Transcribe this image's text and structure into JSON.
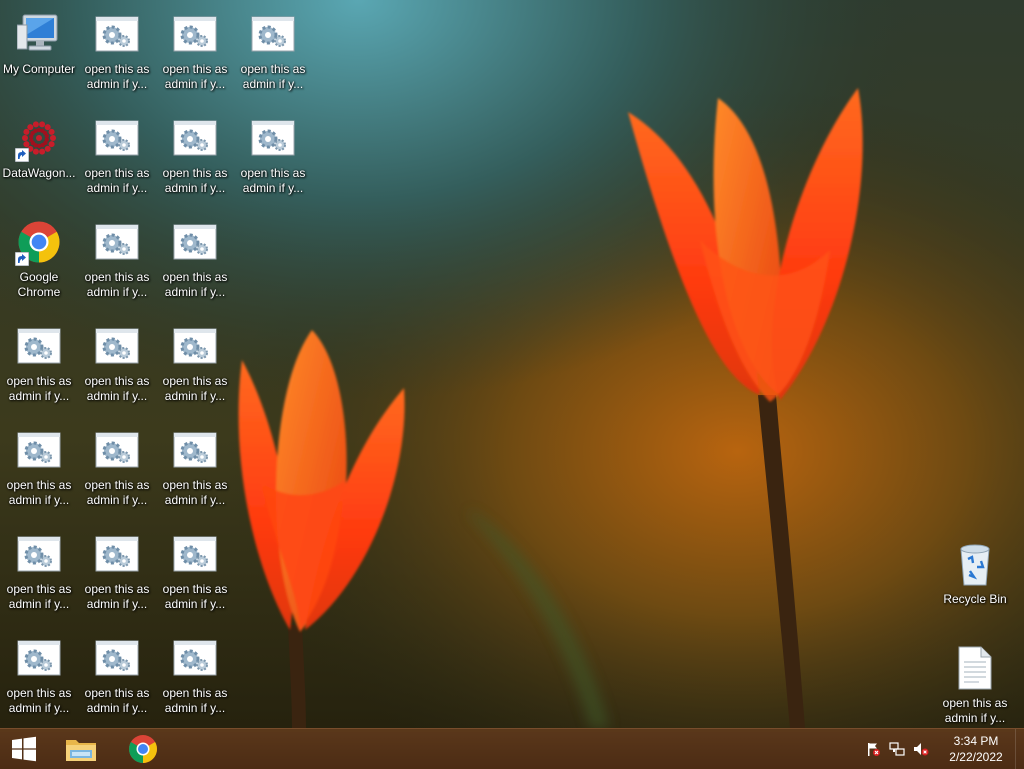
{
  "desktop": {
    "icons": [
      {
        "id": "my-computer",
        "label": "My Computer",
        "kind": "computer-icon",
        "col": 0,
        "row": 0
      },
      {
        "id": "datawagon",
        "label": "DataWagon...",
        "kind": "datawagon-icon",
        "col": 0,
        "row": 1,
        "shortcut": true
      },
      {
        "id": "google-chrome",
        "label": "Google\nChrome",
        "kind": "chrome-icon",
        "col": 0,
        "row": 2,
        "shortcut": true
      },
      {
        "id": "admin-0-3",
        "label": "open this as\nadmin if y...",
        "kind": "settings-file-icon",
        "col": 0,
        "row": 3
      },
      {
        "id": "admin-0-4",
        "label": "open this as\nadmin if y...",
        "kind": "settings-file-icon",
        "col": 0,
        "row": 4
      },
      {
        "id": "admin-0-5",
        "label": "open this as\nadmin if y...",
        "kind": "settings-file-icon",
        "col": 0,
        "row": 5
      },
      {
        "id": "admin-0-6",
        "label": "open this as\nadmin if y...",
        "kind": "settings-file-icon",
        "col": 0,
        "row": 6
      },
      {
        "id": "admin-1-0",
        "label": "open this as\nadmin if y...",
        "kind": "settings-file-icon",
        "col": 1,
        "row": 0
      },
      {
        "id": "admin-1-1",
        "label": "open this as\nadmin if y...",
        "kind": "settings-file-icon",
        "col": 1,
        "row": 1
      },
      {
        "id": "admin-1-2",
        "label": "open this as\nadmin if y...",
        "kind": "settings-file-icon",
        "col": 1,
        "row": 2
      },
      {
        "id": "admin-1-3",
        "label": "open this as\nadmin if y...",
        "kind": "settings-file-icon",
        "col": 1,
        "row": 3
      },
      {
        "id": "admin-1-4",
        "label": "open this as\nadmin if y...",
        "kind": "settings-file-icon",
        "col": 1,
        "row": 4
      },
      {
        "id": "admin-1-5",
        "label": "open this as\nadmin if y...",
        "kind": "settings-file-icon",
        "col": 1,
        "row": 5
      },
      {
        "id": "admin-1-6",
        "label": "open this as\nadmin if y...",
        "kind": "settings-file-icon",
        "col": 1,
        "row": 6
      },
      {
        "id": "admin-2-0",
        "label": "open this as\nadmin if y...",
        "kind": "settings-file-icon",
        "col": 2,
        "row": 0
      },
      {
        "id": "admin-2-1",
        "label": "open this as\nadmin if y...",
        "kind": "settings-file-icon",
        "col": 2,
        "row": 1
      },
      {
        "id": "admin-2-2",
        "label": "open this as\nadmin if y...",
        "kind": "settings-file-icon",
        "col": 2,
        "row": 2
      },
      {
        "id": "admin-2-3",
        "label": "open this as\nadmin if y...",
        "kind": "settings-file-icon",
        "col": 2,
        "row": 3
      },
      {
        "id": "admin-2-4",
        "label": "open this as\nadmin if y...",
        "kind": "settings-file-icon",
        "col": 2,
        "row": 4
      },
      {
        "id": "admin-2-5",
        "label": "open this as\nadmin if y...",
        "kind": "settings-file-icon",
        "col": 2,
        "row": 5
      },
      {
        "id": "admin-2-6",
        "label": "open this as\nadmin if y...",
        "kind": "settings-file-icon",
        "col": 2,
        "row": 6
      },
      {
        "id": "admin-3-0",
        "label": "open this as\nadmin if y...",
        "kind": "settings-file-icon",
        "col": 3,
        "row": 0
      },
      {
        "id": "admin-3-1",
        "label": "open this as\nadmin if y...",
        "kind": "settings-file-icon",
        "col": 3,
        "row": 1
      }
    ],
    "right_icons": [
      {
        "id": "recycle-bin",
        "label": "Recycle Bin",
        "kind": "recycle-bin-icon",
        "row": 5
      },
      {
        "id": "admin-txt",
        "label": "open this as\nadmin if y...",
        "kind": "text-file-icon",
        "row": 6
      }
    ]
  },
  "taskbar": {
    "start_icon": "windows-logo-icon",
    "pinned": [
      {
        "id": "file-explorer",
        "icon": "folder-icon"
      },
      {
        "id": "chrome",
        "icon": "chrome-icon"
      }
    ],
    "tray": {
      "icons": [
        "action-center-flag-icon",
        "network-icon",
        "volume-muted-icon"
      ],
      "time": "3:34 PM",
      "date": "2/22/2022"
    }
  },
  "colors": {
    "taskbar": "#5c3518",
    "tulip": "#ff4a12",
    "chrome_red": "#db4437",
    "chrome_yellow": "#f4c20d",
    "chrome_green": "#0f9d58",
    "chrome_blue": "#4285f4"
  }
}
